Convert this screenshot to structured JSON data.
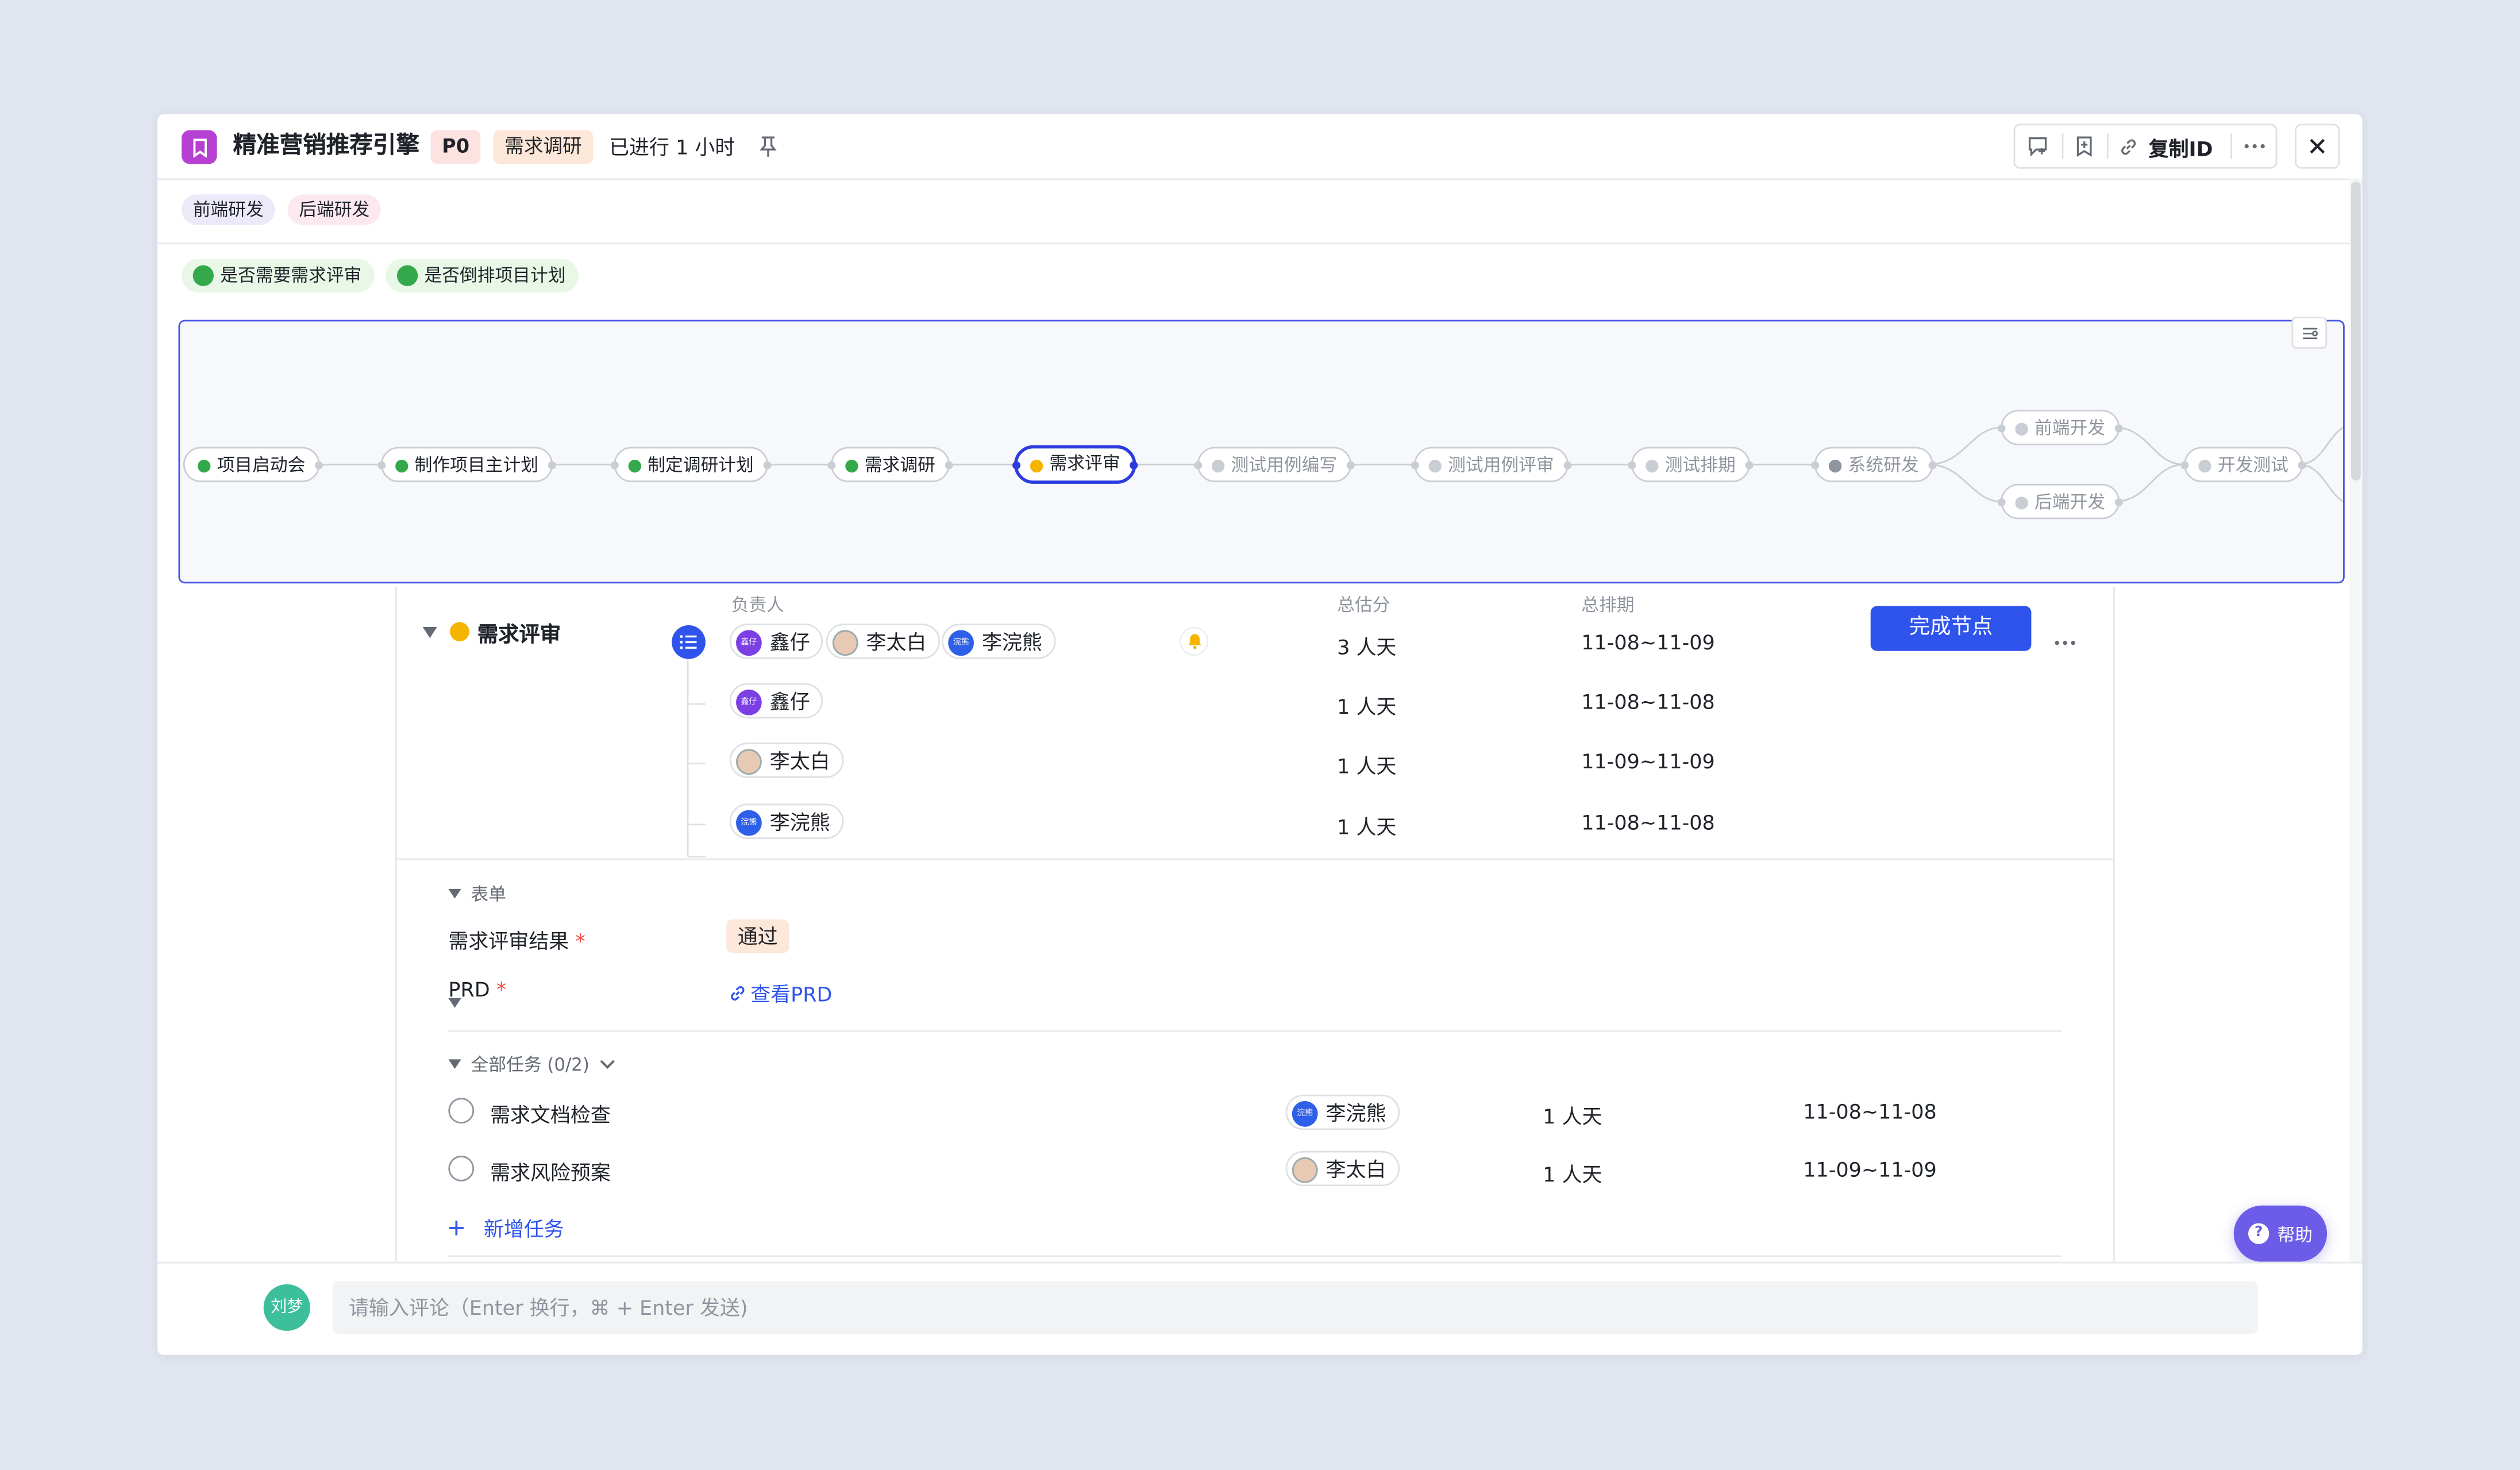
{
  "header": {
    "title": "精准营销推荐引擎",
    "priority": "P0",
    "stage": "需求调研",
    "elapsed": "已进行 1 小时",
    "copy_id_label": "复制ID"
  },
  "team_tags": [
    "前端研发",
    "后端研发"
  ],
  "checks": [
    "是否需要需求评审",
    "是否倒排项目计划"
  ],
  "flow": {
    "nodes": [
      {
        "label": "项目启动会",
        "status": "done"
      },
      {
        "label": "制作项目主计划",
        "status": "done"
      },
      {
        "label": "制定调研计划",
        "status": "done"
      },
      {
        "label": "需求调研",
        "status": "done"
      },
      {
        "label": "需求评审",
        "status": "active"
      },
      {
        "label": "测试用例编写",
        "status": "pending"
      },
      {
        "label": "测试用例评审",
        "status": "pending"
      },
      {
        "label": "测试排期",
        "status": "pending"
      },
      {
        "label": "系统研发",
        "status": "pending"
      },
      {
        "label": "前端开发",
        "status": "pending"
      },
      {
        "label": "后端开发",
        "status": "pending"
      },
      {
        "label": "开发测试",
        "status": "pending"
      }
    ]
  },
  "node_detail": {
    "name": "需求评审",
    "col_owner": "负责人",
    "col_estimate": "总估分",
    "col_schedule": "总排期",
    "complete_label": "完成节点",
    "rows": [
      {
        "people": [
          "鑫仔",
          "李太白",
          "李浣熊"
        ],
        "estimate": "3 人天",
        "schedule": "11-08~11-09"
      },
      {
        "people": [
          "鑫仔"
        ],
        "estimate": "1 人天",
        "schedule": "11-08~11-08"
      },
      {
        "people": [
          "李太白"
        ],
        "estimate": "1 人天",
        "schedule": "11-09~11-09"
      },
      {
        "people": [
          "李浣熊"
        ],
        "estimate": "1 人天",
        "schedule": "11-08~11-08"
      }
    ],
    "avatar_text": {
      "鑫仔": "鑫仔",
      "李浣熊": "浣熊"
    }
  },
  "form": {
    "section_label": "表单",
    "fields": [
      {
        "label": "需求评审结果",
        "value": "通过"
      },
      {
        "label": "PRD",
        "value": "查看PRD"
      }
    ]
  },
  "tasks": {
    "section_label": "全部任务 (0/2)",
    "items": [
      {
        "name": "需求文档检查",
        "owner": "李浣熊",
        "estimate": "1 人天",
        "schedule": "11-08~11-08"
      },
      {
        "name": "需求风险预案",
        "owner": "李太白",
        "estimate": "1 人天",
        "schedule": "11-09~11-09"
      }
    ],
    "add_label": "新增任务"
  },
  "help_label": "帮助",
  "comment": {
    "avatar": "刘梦",
    "placeholder": "请输入评论（Enter 换行，⌘ + Enter 发送)"
  },
  "colors": {
    "accent": "#2f54eb",
    "done": "#34a94c",
    "active": "#f5b400",
    "help": "#6c5ce7"
  }
}
